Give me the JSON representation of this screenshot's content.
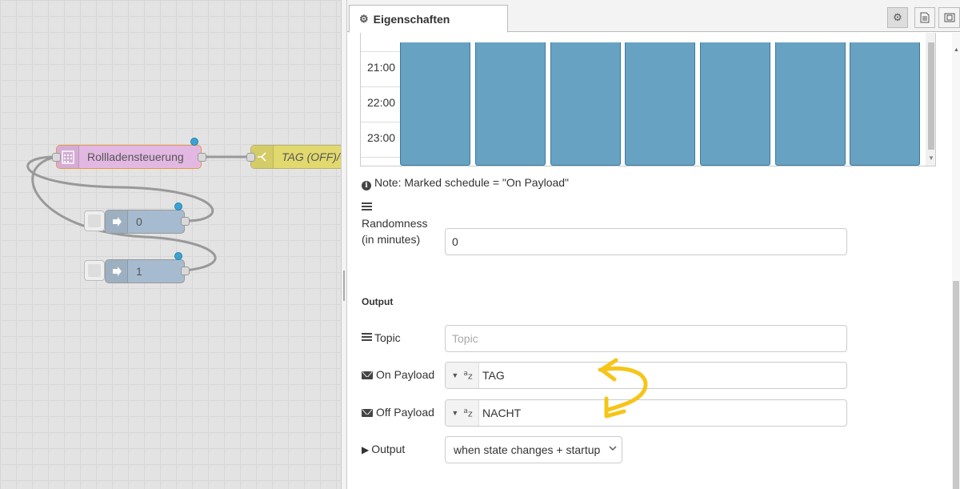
{
  "canvas": {
    "nodes": {
      "rollladen": {
        "label": "Rollladensteuerung",
        "icon": "calendar-icon",
        "color": "#e2b8e2"
      },
      "switch": {
        "label": "TAG (OFF)/",
        "icon": "switch-icon",
        "color": "#e2d96e"
      },
      "inject0": {
        "label": "0",
        "icon": "inject-arrow-icon",
        "color": "#a6bbcf"
      },
      "inject1": {
        "label": "1",
        "icon": "inject-arrow-icon",
        "color": "#a6bbcf"
      }
    }
  },
  "sidebar": {
    "tab_label": "Eigenschaften",
    "tools": [
      "gear-icon",
      "document-icon",
      "frame-icon"
    ]
  },
  "schedule": {
    "times": [
      "21:00",
      "22:00",
      "23:00"
    ],
    "days": 7,
    "block_color": "#68a2c3"
  },
  "note": "Note: Marked schedule = \"On Payload\"",
  "randomness": {
    "label_line1": "Randomness",
    "label_line2": "(in minutes)",
    "value": "0"
  },
  "output_section": {
    "title": "Output"
  },
  "topic": {
    "label": "Topic",
    "placeholder": "Topic",
    "value": ""
  },
  "on_payload": {
    "label": "On Payload",
    "type": "string",
    "value": "TAG"
  },
  "off_payload": {
    "label": "Off Payload",
    "type": "string",
    "value": "NACHT"
  },
  "output": {
    "label": "Output",
    "selected": "when state changes + startup"
  },
  "colors": {
    "annotation": "#f5c518",
    "accent": "#3aa3d6"
  }
}
